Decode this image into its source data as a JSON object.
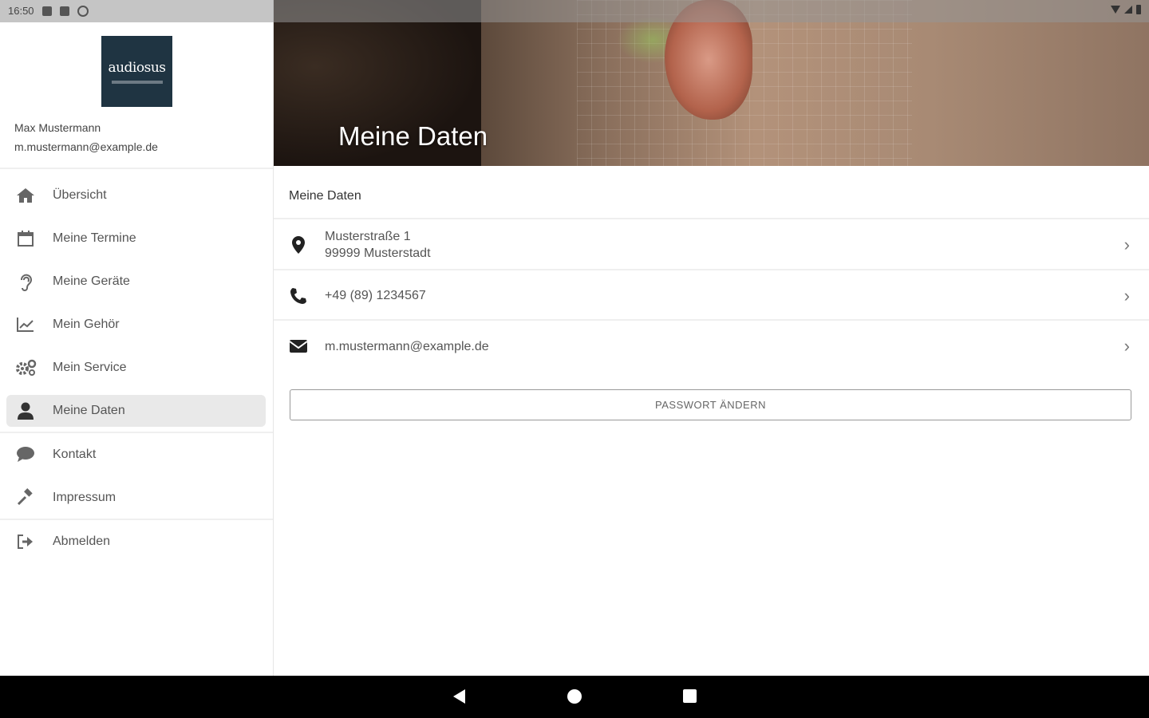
{
  "status_bar": {
    "time": "16:50"
  },
  "sidebar": {
    "logo_text": "audiosus",
    "user_name": "Max Mustermann",
    "user_email": "m.mustermann@example.de",
    "items": [
      {
        "label": "Übersicht",
        "icon": "home-icon"
      },
      {
        "label": "Meine Termine",
        "icon": "calendar-icon"
      },
      {
        "label": "Meine Geräte",
        "icon": "hearing-icon"
      },
      {
        "label": "Mein Gehör",
        "icon": "chart-icon"
      },
      {
        "label": "Mein Service",
        "icon": "gears-icon"
      },
      {
        "label": "Meine Daten",
        "icon": "user-icon",
        "active": true
      },
      {
        "label": "Kontakt",
        "icon": "chat-icon"
      },
      {
        "label": "Impressum",
        "icon": "gavel-icon"
      },
      {
        "label": "Abmelden",
        "icon": "logout-icon"
      }
    ]
  },
  "main": {
    "hero_title": "Meine Daten",
    "section_title": "Meine Daten",
    "address_line1": "Musterstraße 1",
    "address_line2": "99999 Musterstadt",
    "phone": "+49 (89) 1234567",
    "email": "m.mustermann@example.de",
    "password_button": "PASSWORT ÄNDERN"
  },
  "colors": {
    "logo_bg": "#1f3442",
    "active_bg": "#e9e9e9"
  }
}
